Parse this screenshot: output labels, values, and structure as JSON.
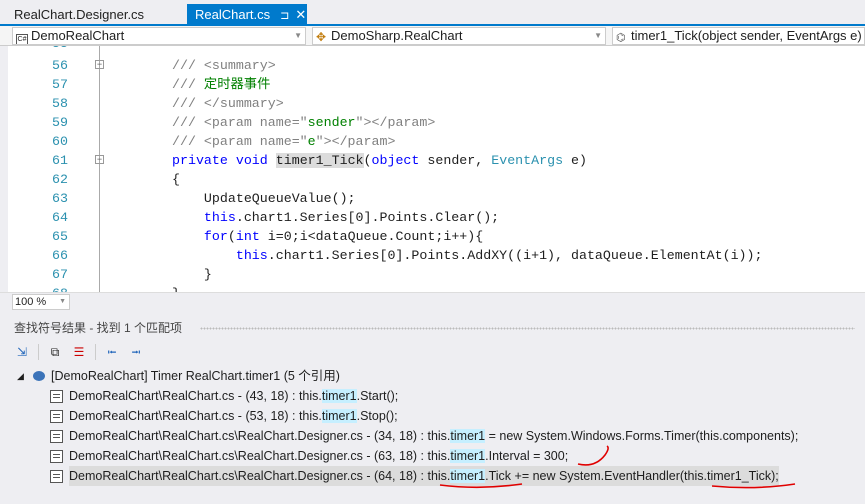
{
  "tabs": [
    {
      "label": "RealChart.Designer.cs",
      "active": false
    },
    {
      "label": "RealChart.cs",
      "active": true,
      "pin": "⊐",
      "close": "✕"
    }
  ],
  "nav": {
    "project": "DemoRealChart",
    "class": "DemoSharp.RealChart",
    "member": "timer1_Tick(object sender, EventArgs e)"
  },
  "code": {
    "partial_top": "55",
    "lines": [
      {
        "n": "56",
        "fold": "−",
        "t": [
          [
            "/// ",
            "cm"
          ],
          [
            "<summary>",
            "cm"
          ]
        ]
      },
      {
        "n": "57",
        "t": [
          [
            "/// ",
            "cm"
          ],
          [
            "定时器事件",
            "cg"
          ]
        ]
      },
      {
        "n": "58",
        "t": [
          [
            "/// ",
            "cm"
          ],
          [
            "</summary>",
            "cm"
          ]
        ]
      },
      {
        "n": "59",
        "t": [
          [
            "/// ",
            "cm"
          ],
          [
            "<param name=\"",
            "cm"
          ],
          [
            "sender",
            "cg"
          ],
          [
            "\"></param>",
            "cm"
          ]
        ]
      },
      {
        "n": "60",
        "t": [
          [
            "/// ",
            "cm"
          ],
          [
            "<param name=\"",
            "cm"
          ],
          [
            "e",
            "cg"
          ],
          [
            "\"></param>",
            "cm"
          ]
        ]
      },
      {
        "n": "61",
        "fold": "−",
        "t": [
          [
            "private",
            "kw"
          ],
          [
            " ",
            ""
          ],
          [
            "void",
            "kw"
          ],
          [
            " ",
            ""
          ],
          [
            "timer1_Tick",
            "hl"
          ],
          [
            "(",
            ""
          ],
          [
            "object",
            "kw"
          ],
          [
            " sender, ",
            ""
          ],
          [
            "EventArgs",
            "ty"
          ],
          [
            " e)",
            ""
          ]
        ]
      },
      {
        "n": "62",
        "t": [
          [
            "{",
            ""
          ]
        ]
      },
      {
        "n": "63",
        "t": [
          [
            "    UpdateQueueValue();",
            ""
          ]
        ]
      },
      {
        "n": "64",
        "t": [
          [
            "    ",
            ""
          ],
          [
            "this",
            "kw"
          ],
          [
            ".chart1.Series[0].Points.Clear();",
            ""
          ]
        ]
      },
      {
        "n": "65",
        "t": [
          [
            "    ",
            ""
          ],
          [
            "for",
            "kw"
          ],
          [
            "(",
            ""
          ],
          [
            "int",
            "kw"
          ],
          [
            " i=0;i<dataQueue.Count;i++){",
            ""
          ]
        ]
      },
      {
        "n": "66",
        "t": [
          [
            "        ",
            ""
          ],
          [
            "this",
            "kw"
          ],
          [
            ".chart1.Series[0].Points.AddXY((i+1), dataQueue.ElementAt(i));",
            ""
          ]
        ]
      },
      {
        "n": "67",
        "t": [
          [
            "    }",
            ""
          ]
        ]
      },
      {
        "n": "68",
        "t": [
          [
            "}",
            ""
          ]
        ]
      }
    ]
  },
  "zoom": "100 %",
  "results": {
    "title": "查找符号结果 - 找到 1 个匹配项",
    "root": "[DemoRealChart] Timer RealChart.timer1 (5 个引用)",
    "rows": [
      {
        "pre": "DemoRealChart\\RealChart.cs - (43, 18) : this.",
        "match": "timer1",
        "post": ".Start();"
      },
      {
        "pre": "DemoRealChart\\RealChart.cs - (53, 18) : this.",
        "match": "timer1",
        "post": ".Stop();"
      },
      {
        "pre": "DemoRealChart\\RealChart.cs\\RealChart.Designer.cs - (34, 18) : this.",
        "match": "timer1",
        "post": " = new System.Windows.Forms.Timer(this.components);"
      },
      {
        "pre": "DemoRealChart\\RealChart.cs\\RealChart.Designer.cs - (63, 18) : this.",
        "match": "timer1",
        "post": ".Interval = 300;"
      },
      {
        "pre": "DemoRealChart\\RealChart.cs\\RealChart.Designer.cs - (64, 18) : this.",
        "match": "timer1",
        "post": ".Tick += new System.EventHandler(this.timer1_Tick);",
        "selected": true
      }
    ]
  },
  "colors": {
    "accent": "#007acc",
    "annotation": "#e00000",
    "match_highlight": "#c6efff"
  }
}
